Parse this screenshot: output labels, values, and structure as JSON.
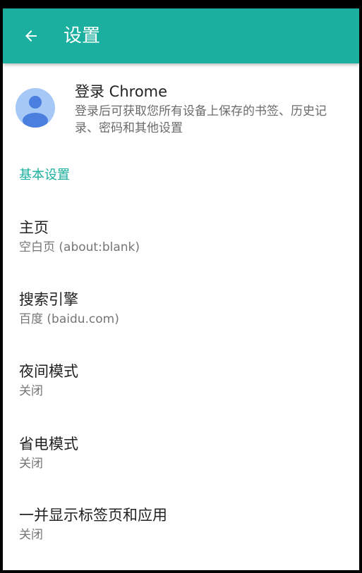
{
  "app_bar": {
    "title": "设置",
    "back_icon": "arrow-back-icon",
    "color": "#1aaf9f"
  },
  "account": {
    "title": "登录 Chrome",
    "description": "登录后可获取您所有设备上保存的书签、历史记录、密码和其他设置",
    "avatar_icon": "account-avatar-icon",
    "avatar_bg": "#a6c8f7",
    "avatar_fg": "#4a7fe0"
  },
  "section": {
    "header": "基本设置"
  },
  "settings": [
    {
      "title": "主页",
      "summary": "空白页 (about:blank)"
    },
    {
      "title": "搜索引擎",
      "summary": "百度 (baidu.com)"
    },
    {
      "title": "夜间模式",
      "summary": "关闭"
    },
    {
      "title": "省电模式",
      "summary": "关闭"
    },
    {
      "title": "一并显示标签页和应用",
      "summary": "关闭"
    }
  ]
}
